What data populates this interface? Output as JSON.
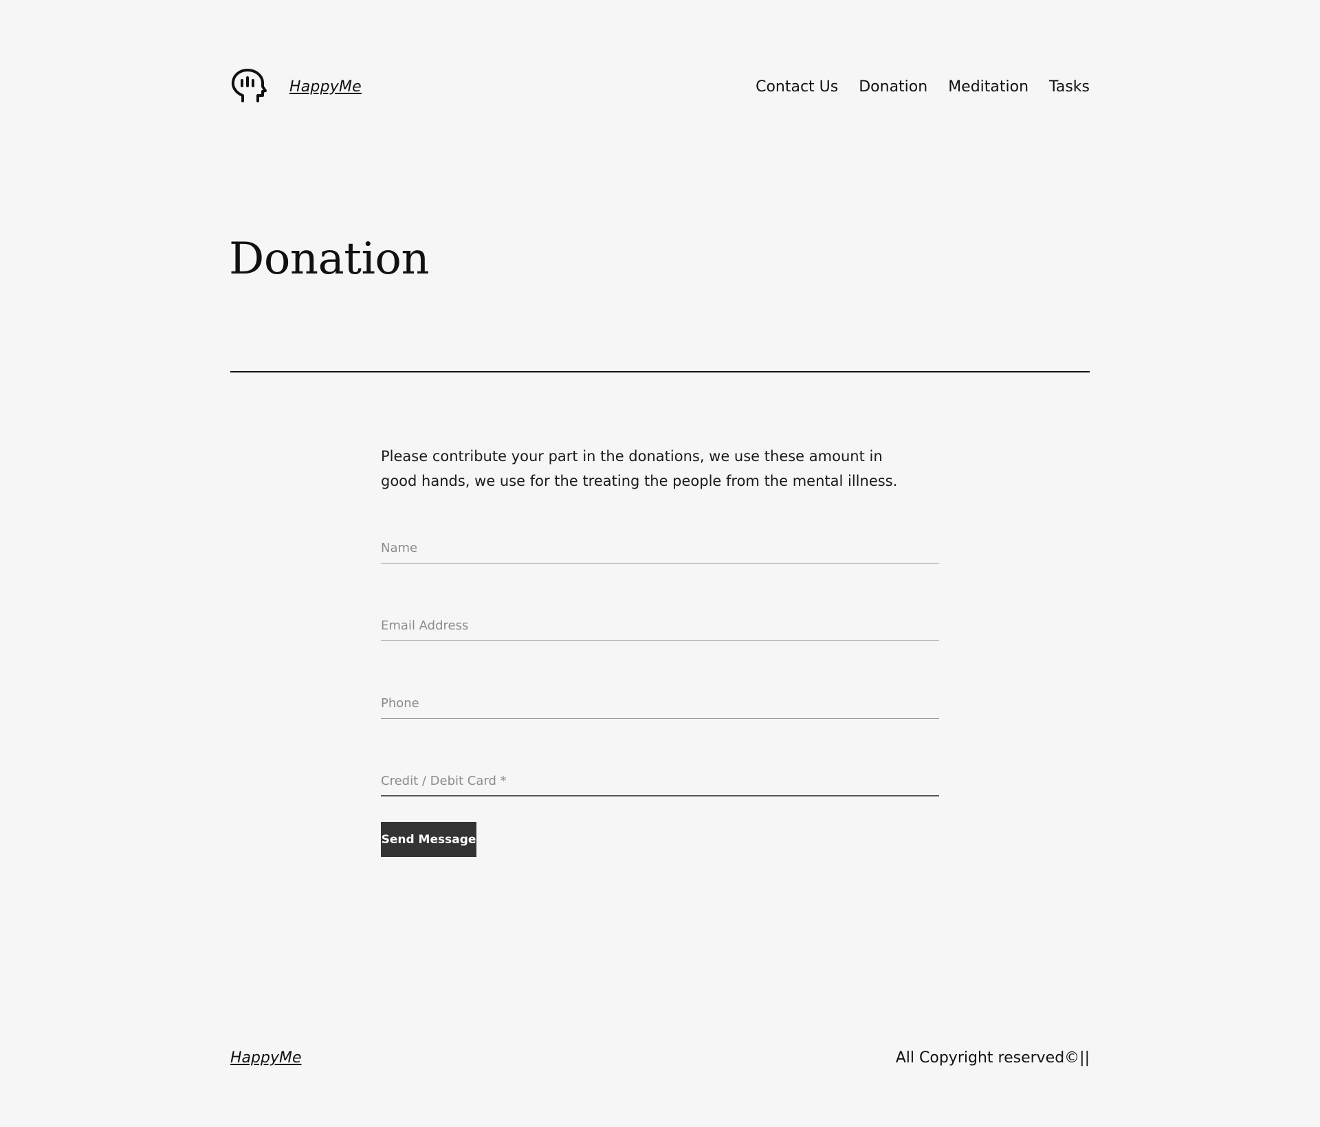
{
  "header": {
    "logo_icon": "happy-head-icon",
    "site_title": "HappyMe",
    "nav": [
      "Contact Us",
      "Donation",
      "Meditation",
      "Tasks"
    ]
  },
  "main": {
    "title": "Donation",
    "intro": "Please contribute your part in the donations, we use these amount in good hands, we use for the treating the people from the mental illness.",
    "form": {
      "name_placeholder": "Name",
      "email_placeholder": "Email Address",
      "phone_placeholder": "Phone",
      "card_placeholder": "Credit / Debit Card *",
      "submit_label": "Send Message"
    }
  },
  "footer": {
    "brand": "HappyMe",
    "copyright": "All Copyright reserved©||"
  }
}
